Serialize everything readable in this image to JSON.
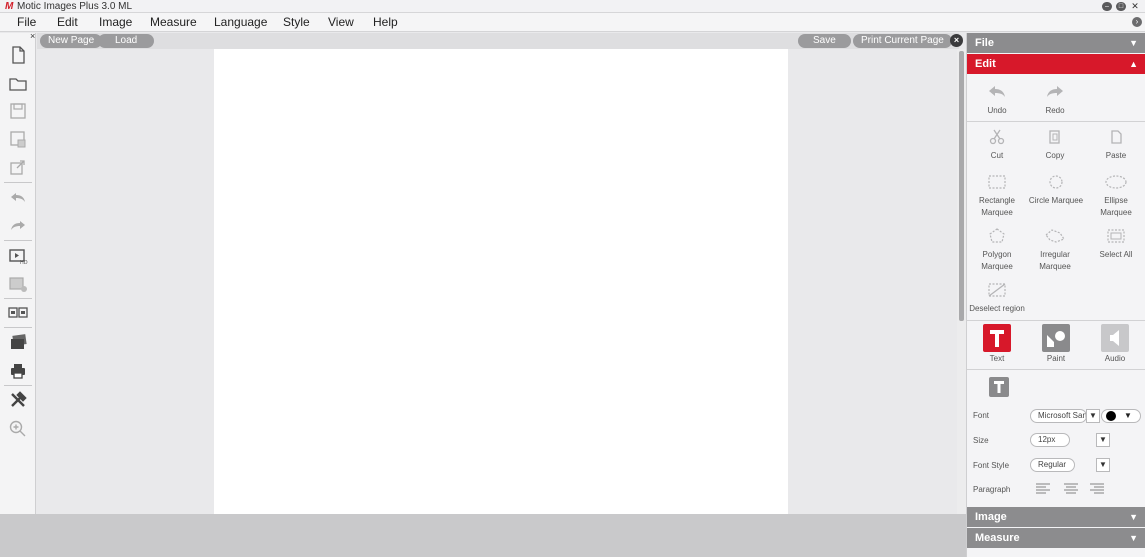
{
  "window": {
    "title": "Motic Images Plus 3.0 ML",
    "logo": "M"
  },
  "menu": [
    "File",
    "Edit",
    "Image",
    "Measure",
    "Language",
    "Style",
    "View",
    "Help"
  ],
  "topbar": {
    "new_page": "New Page",
    "load": "Load",
    "save": "Save",
    "print_current_page": "Print Current Page",
    "close": "×"
  },
  "left_toolbar": {
    "close": "×",
    "tools": [
      "new-file-icon",
      "open-folder-icon",
      "save-icon",
      "save-as-icon",
      "export-icon",
      "undo-icon",
      "redo-icon",
      "video-capture-icon",
      "capture-icon",
      "compare-icon",
      "gallery-icon",
      "print-icon",
      "tools-icon",
      "zoom-in-icon"
    ]
  },
  "right_panel": {
    "sections": {
      "file": "File",
      "edit": "Edit",
      "image": "Image",
      "measure": "Measure"
    },
    "edit_tools": {
      "undo": "Undo",
      "redo": "Redo",
      "cut": "Cut",
      "copy": "Copy",
      "paste": "Paste",
      "rect_line1": "Rectangle",
      "rect_line2": "Marquee",
      "circle": "Circle Marquee",
      "ellipse_line1": "Ellipse",
      "ellipse_line2": "Marquee",
      "polygon_line1": "Polygon",
      "polygon_line2": "Marquee",
      "irregular_line1": "Irregular",
      "irregular_line2": "Marquee",
      "select_all": "Select All",
      "deselect": "Deselect region"
    },
    "annotation_tabs": {
      "text": "Text",
      "paint": "Paint",
      "audio": "Audio"
    },
    "text_props": {
      "font_label": "Font",
      "font_value": "Microsoft Sans",
      "size_label": "Size",
      "size_value": "12px",
      "style_label": "Font Style",
      "style_value": "Regular",
      "paragraph_label": "Paragraph"
    }
  },
  "colors": {
    "accent": "#d7182a",
    "header": "#8c8c8e"
  }
}
